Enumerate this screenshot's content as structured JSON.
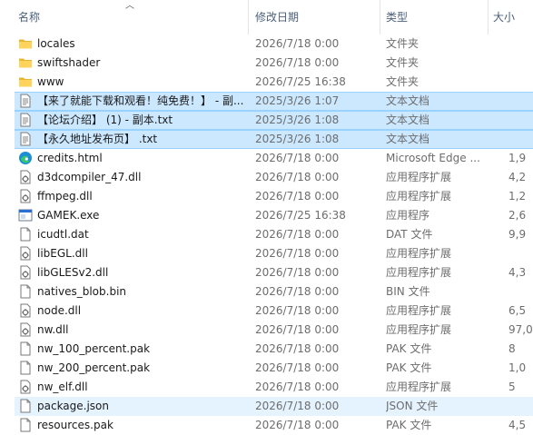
{
  "columns": {
    "name": "名称",
    "date": "修改日期",
    "type": "类型",
    "size": "大小"
  },
  "files": [
    {
      "name": "locales",
      "date": "2026/7/18 0:00",
      "type": "文件夹",
      "size": "",
      "icon": "folder-icon",
      "state": ""
    },
    {
      "name": "swiftshader",
      "date": "2026/7/18 0:00",
      "type": "文件夹",
      "size": "",
      "icon": "folder-icon",
      "state": ""
    },
    {
      "name": "www",
      "date": "2026/7/25 16:38",
      "type": "文件夹",
      "size": "",
      "icon": "folder-icon",
      "state": ""
    },
    {
      "name": "【来了就能下载和观看！纯免费！】 - 副...",
      "date": "2025/3/26 1:07",
      "type": "文本文档",
      "size": "",
      "icon": "text-file-icon",
      "state": "selected"
    },
    {
      "name": "【论坛介绍】 (1) - 副本.txt",
      "date": "2025/3/26 1:08",
      "type": "文本文档",
      "size": "",
      "icon": "text-file-icon",
      "state": "selected"
    },
    {
      "name": "【永久地址发布页】 .txt",
      "date": "2025/3/26 1:08",
      "type": "文本文档",
      "size": "",
      "icon": "text-file-icon",
      "state": "selected"
    },
    {
      "name": "credits.html",
      "date": "2026/7/18 0:00",
      "type": "Microsoft Edge ...",
      "size": "1,9",
      "icon": "edge-icon",
      "state": ""
    },
    {
      "name": "d3dcompiler_47.dll",
      "date": "2026/7/18 0:00",
      "type": "应用程序扩展",
      "size": "4,2",
      "icon": "dll-icon",
      "state": ""
    },
    {
      "name": "ffmpeg.dll",
      "date": "2026/7/18 0:00",
      "type": "应用程序扩展",
      "size": "1,2",
      "icon": "dll-icon",
      "state": ""
    },
    {
      "name": "GAMEK.exe",
      "date": "2026/7/25 16:38",
      "type": "应用程序",
      "size": "2,6",
      "icon": "exe-icon",
      "state": ""
    },
    {
      "name": "icudtl.dat",
      "date": "2026/7/18 0:00",
      "type": "DAT 文件",
      "size": "9,9",
      "icon": "file-icon",
      "state": ""
    },
    {
      "name": "libEGL.dll",
      "date": "2026/7/18 0:00",
      "type": "应用程序扩展",
      "size": "",
      "icon": "dll-icon",
      "state": ""
    },
    {
      "name": "libGLESv2.dll",
      "date": "2026/7/18 0:00",
      "type": "应用程序扩展",
      "size": "4,3",
      "icon": "dll-icon",
      "state": ""
    },
    {
      "name": "natives_blob.bin",
      "date": "2026/7/18 0:00",
      "type": "BIN 文件",
      "size": "",
      "icon": "file-icon",
      "state": ""
    },
    {
      "name": "node.dll",
      "date": "2026/7/18 0:00",
      "type": "应用程序扩展",
      "size": "6,5",
      "icon": "dll-icon",
      "state": ""
    },
    {
      "name": "nw.dll",
      "date": "2026/7/18 0:00",
      "type": "应用程序扩展",
      "size": "97,0",
      "icon": "dll-icon",
      "state": ""
    },
    {
      "name": "nw_100_percent.pak",
      "date": "2026/7/18 0:00",
      "type": "PAK 文件",
      "size": "8",
      "icon": "file-icon",
      "state": ""
    },
    {
      "name": "nw_200_percent.pak",
      "date": "2026/7/18 0:00",
      "type": "PAK 文件",
      "size": "1,0",
      "icon": "file-icon",
      "state": ""
    },
    {
      "name": "nw_elf.dll",
      "date": "2026/7/18 0:00",
      "type": "应用程序扩展",
      "size": "5",
      "icon": "dll-icon",
      "state": ""
    },
    {
      "name": "package.json",
      "date": "2026/7/18 0:00",
      "type": "JSON 文件",
      "size": "",
      "icon": "file-icon",
      "state": "hover"
    },
    {
      "name": "resources.pak",
      "date": "2026/7/18 0:00",
      "type": "PAK 文件",
      "size": "4,5",
      "icon": "file-icon",
      "state": ""
    }
  ]
}
